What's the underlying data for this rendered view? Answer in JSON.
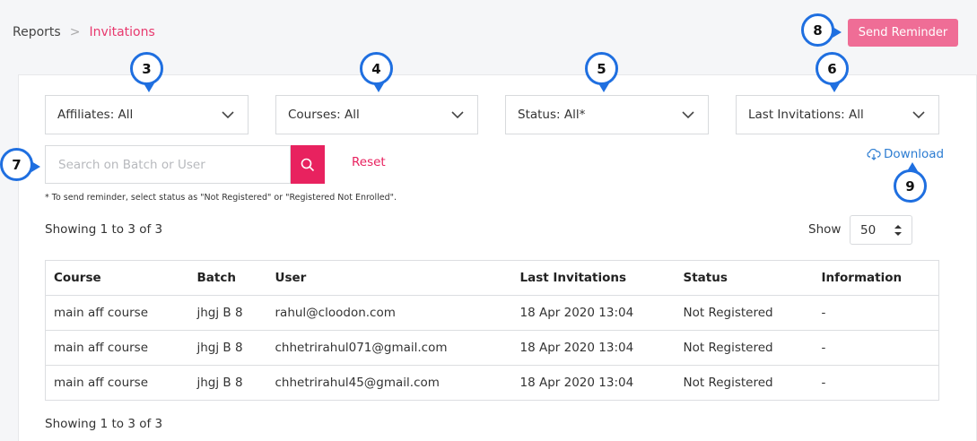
{
  "breadcrumb": {
    "parent": "Reports",
    "separator": ">",
    "current": "Invitations"
  },
  "actions": {
    "send_reminder": "Send Reminder"
  },
  "filters": {
    "affiliates": "Affiliates: All",
    "courses": "Courses: All",
    "status": "Status: All*",
    "last_invitations": "Last Invitations: All"
  },
  "search": {
    "placeholder": "Search on Batch or User",
    "value": ""
  },
  "reset_label": "Reset",
  "download_label": "Download",
  "note": "* To send reminder, select status as \"Not Registered\" or \"Registered Not Enrolled\".",
  "showing_top": "Showing 1 to 3 of 3",
  "showing_bottom": "Showing 1 to 3 of 3",
  "page_size": {
    "label": "Show",
    "value": "50"
  },
  "table": {
    "headers": [
      "Course",
      "Batch",
      "User",
      "Last Invitations",
      "Status",
      "Information"
    ],
    "rows": [
      [
        "main aff course",
        "jhgj B 8",
        "rahul@cloodon.com",
        "18 Apr 2020 13:04",
        "Not Registered",
        "-"
      ],
      [
        "main aff course",
        "jhgj B 8",
        "chhetrirahul071@gmail.com",
        "18 Apr 2020 13:04",
        "Not Registered",
        "-"
      ],
      [
        "main aff course",
        "jhgj B 8",
        "chhetrirahul45@gmail.com",
        "18 Apr 2020 13:04",
        "Not Registered",
        "-"
      ]
    ]
  },
  "markers": [
    "3",
    "4",
    "5",
    "6",
    "7",
    "8",
    "9"
  ],
  "colors": {
    "accent": "#e8225f",
    "send_button": "#ef6d96",
    "link": "#2d7dd2",
    "marker_border": "#1f6fe0"
  },
  "icons": {
    "search": "search-icon",
    "download": "cloud-download-icon",
    "dropdown": "chevron-down-icon",
    "page_size": "sort-arrows-icon"
  }
}
